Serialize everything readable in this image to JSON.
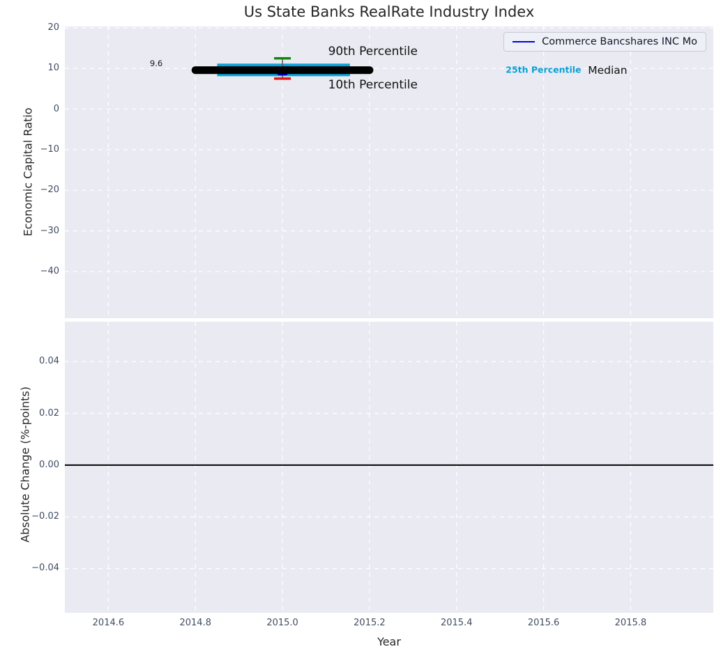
{
  "title": "Us State Banks RealRate Industry Index",
  "legend": {
    "label": "Commerce Bancshares INC Mo",
    "line_color": "#0202dd"
  },
  "colors": {
    "figure_bg": "#ffffff",
    "axes_bg": "#eaebf2",
    "grid": "#ffffff",
    "tick_label": "#3f4c63",
    "text": "#262626"
  },
  "chart_data": [
    {
      "type": "box",
      "panel": "top",
      "title": "Us State Banks RealRate Industry Index",
      "ylabel": "Economic Capital Ratio",
      "xlim": [
        2014.5,
        2015.99
      ],
      "ylim": [
        -51.5,
        20.35
      ],
      "grid": true,
      "yticks": [
        {
          "v": 20,
          "label": "20"
        },
        {
          "v": 10,
          "label": "10"
        },
        {
          "v": 0,
          "label": "0"
        },
        {
          "v": -10,
          "label": "−10"
        },
        {
          "v": -20,
          "label": "−20"
        },
        {
          "v": -30,
          "label": "−30"
        },
        {
          "v": -40,
          "label": "−40"
        }
      ],
      "xticks": [
        {
          "v": 2014.6,
          "label": "2014.6"
        },
        {
          "v": 2014.8,
          "label": "2014.8"
        },
        {
          "v": 2015.0,
          "label": "2015.0"
        },
        {
          "v": 2015.2,
          "label": "2015.2"
        },
        {
          "v": 2015.4,
          "label": "2015.4"
        },
        {
          "v": 2015.6,
          "label": "2015.6"
        },
        {
          "v": 2015.8,
          "label": "2015.8"
        }
      ],
      "median_line": {
        "x0": 2014.8,
        "x1": 2015.2,
        "value": 9.6,
        "color": "#000000",
        "width": 11
      },
      "iqr_band": {
        "x0": 2014.85,
        "x1": 2015.155,
        "p25": 8.1,
        "p75": 11.2,
        "color": "#0ba1d8"
      },
      "whisker": {
        "x": 2015.0,
        "p10": 7.5,
        "p90": 12.5,
        "stem_color": "#555555",
        "p90_color": "#0f8a0f",
        "p10_color": "#e51212"
      },
      "company_marker": {
        "x": 2015.0,
        "value": 8.9,
        "color": "#0000cd"
      },
      "annotations": [
        {
          "id": "median-value",
          "text": "9.6",
          "x": 2014.71,
          "y": 11.3,
          "size": 11.5,
          "color": "#1a1a1a",
          "align": "center",
          "bold": false
        },
        {
          "id": "p90-label",
          "text": "90th Percentile",
          "x": 2015.105,
          "y": 14.2,
          "size": 17,
          "color": "#111111",
          "align": "left",
          "bold": false
        },
        {
          "id": "p10-label",
          "text": "10th Percentile",
          "x": 2015.105,
          "y": 5.9,
          "size": 17,
          "color": "#111111",
          "align": "left",
          "bold": false
        },
        {
          "id": "p25-label",
          "text": "25th Percentile",
          "x": 2015.513,
          "y": 9.72,
          "size": 12.5,
          "color": "#0a9fd6",
          "align": "left",
          "bold": true
        },
        {
          "id": "median-label",
          "text": "Median",
          "x": 2015.702,
          "y": 9.55,
          "size": 15.5,
          "color": "#111111",
          "align": "left",
          "bold": false
        }
      ]
    },
    {
      "type": "line",
      "panel": "bottom",
      "ylabel": "Absolute Change (%-points)",
      "xlabel": "Year",
      "xlim": [
        2014.5,
        2015.99
      ],
      "ylim": [
        -0.0571,
        0.0554
      ],
      "grid": true,
      "yticks": [
        {
          "v": 0.04,
          "label": "0.04"
        },
        {
          "v": 0.02,
          "label": "0.02"
        },
        {
          "v": 0.0,
          "label": "0.00"
        },
        {
          "v": -0.02,
          "label": "−0.02"
        },
        {
          "v": -0.04,
          "label": "−0.04"
        }
      ],
      "xticks": [
        {
          "v": 2014.6,
          "label": "2014.6"
        },
        {
          "v": 2014.8,
          "label": "2014.8"
        },
        {
          "v": 2015.0,
          "label": "2015.0"
        },
        {
          "v": 2015.2,
          "label": "2015.2"
        },
        {
          "v": 2015.4,
          "label": "2015.4"
        },
        {
          "v": 2015.6,
          "label": "2015.6"
        },
        {
          "v": 2015.8,
          "label": "2015.8"
        }
      ],
      "zero_line": {
        "value": 0.0,
        "color": "#000000",
        "width": 2
      },
      "series": []
    }
  ]
}
